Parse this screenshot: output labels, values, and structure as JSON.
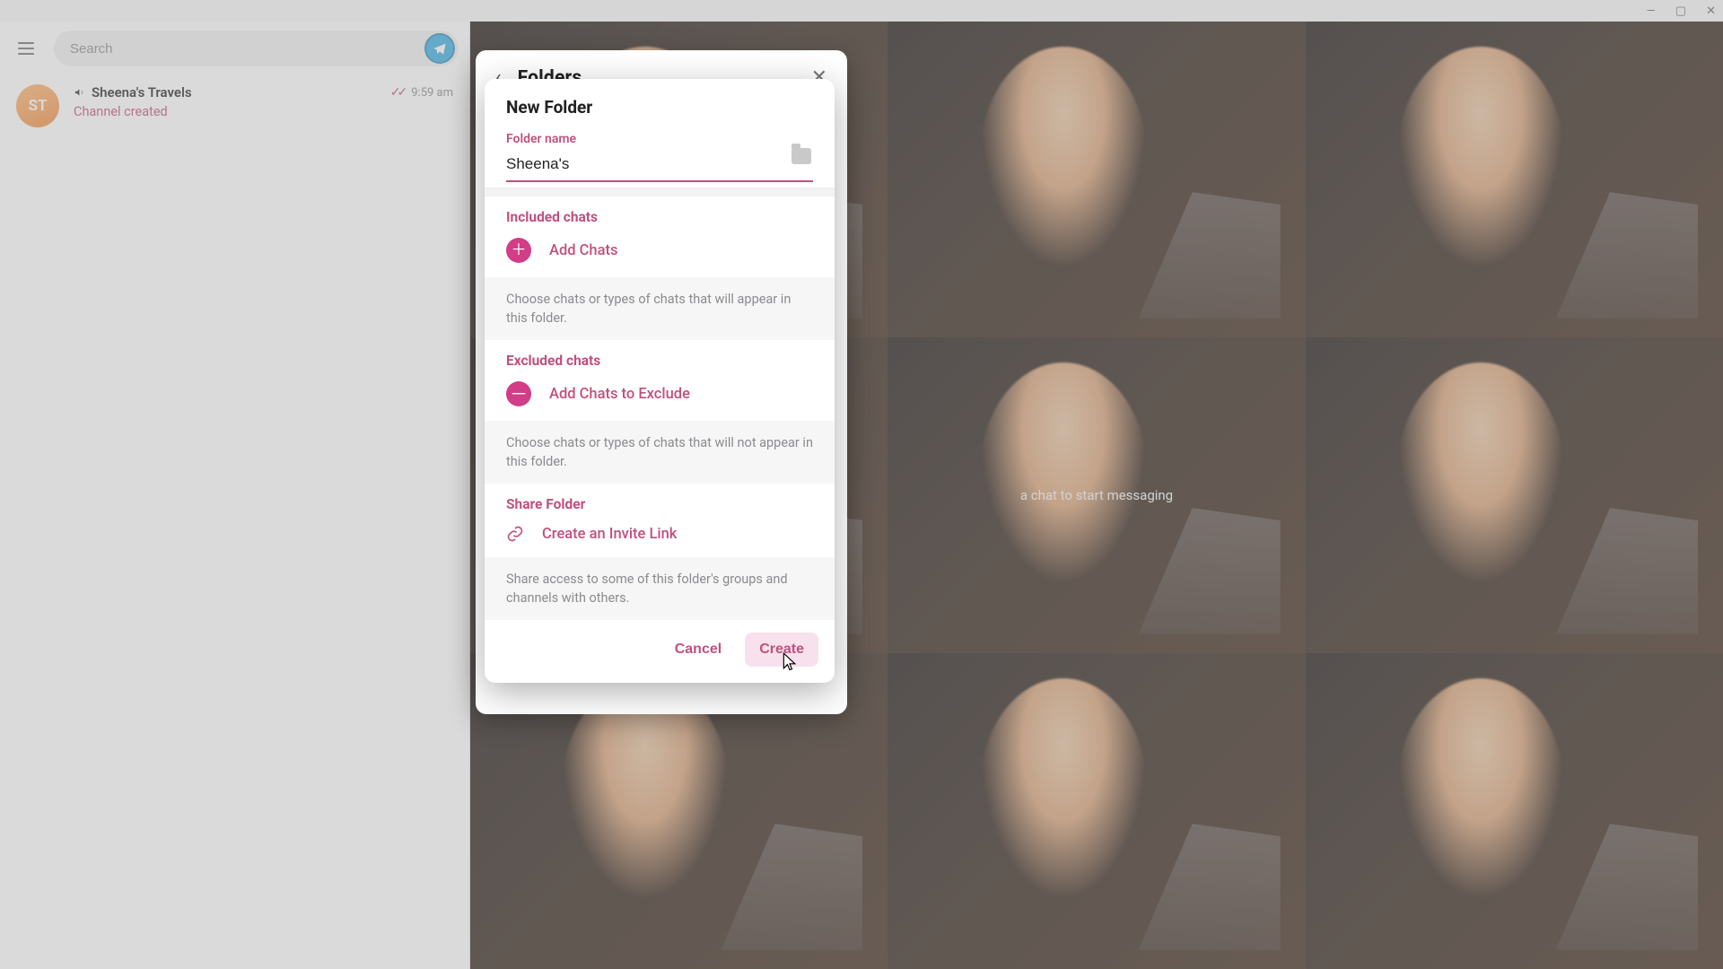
{
  "window_controls": {
    "minimize": "—",
    "maximize": "▢",
    "close": "✕"
  },
  "sidebar": {
    "search_placeholder": "Search",
    "chat": {
      "avatar_initials": "ST",
      "name": "Sheena's Travels",
      "subtitle": "Channel created",
      "time": "9:59 am"
    }
  },
  "main": {
    "hint_partial": "a chat to start messaging"
  },
  "folders_panel": {
    "title": "Folders"
  },
  "dialog": {
    "title": "New Folder",
    "folder_name_label": "Folder name",
    "folder_name_value": "Sheena's",
    "included": {
      "title": "Included chats",
      "add_label": "Add Chats",
      "helper": "Choose chats or types of chats that will appear in this folder."
    },
    "excluded": {
      "title": "Excluded chats",
      "add_label": "Add Chats to Exclude",
      "helper": "Choose chats or types of chats that will not appear in this folder."
    },
    "share": {
      "title": "Share Folder",
      "link_label": "Create an Invite Link",
      "helper": "Share access to some of this folder's groups and channels with others."
    },
    "cancel": "Cancel",
    "create": "Create"
  }
}
